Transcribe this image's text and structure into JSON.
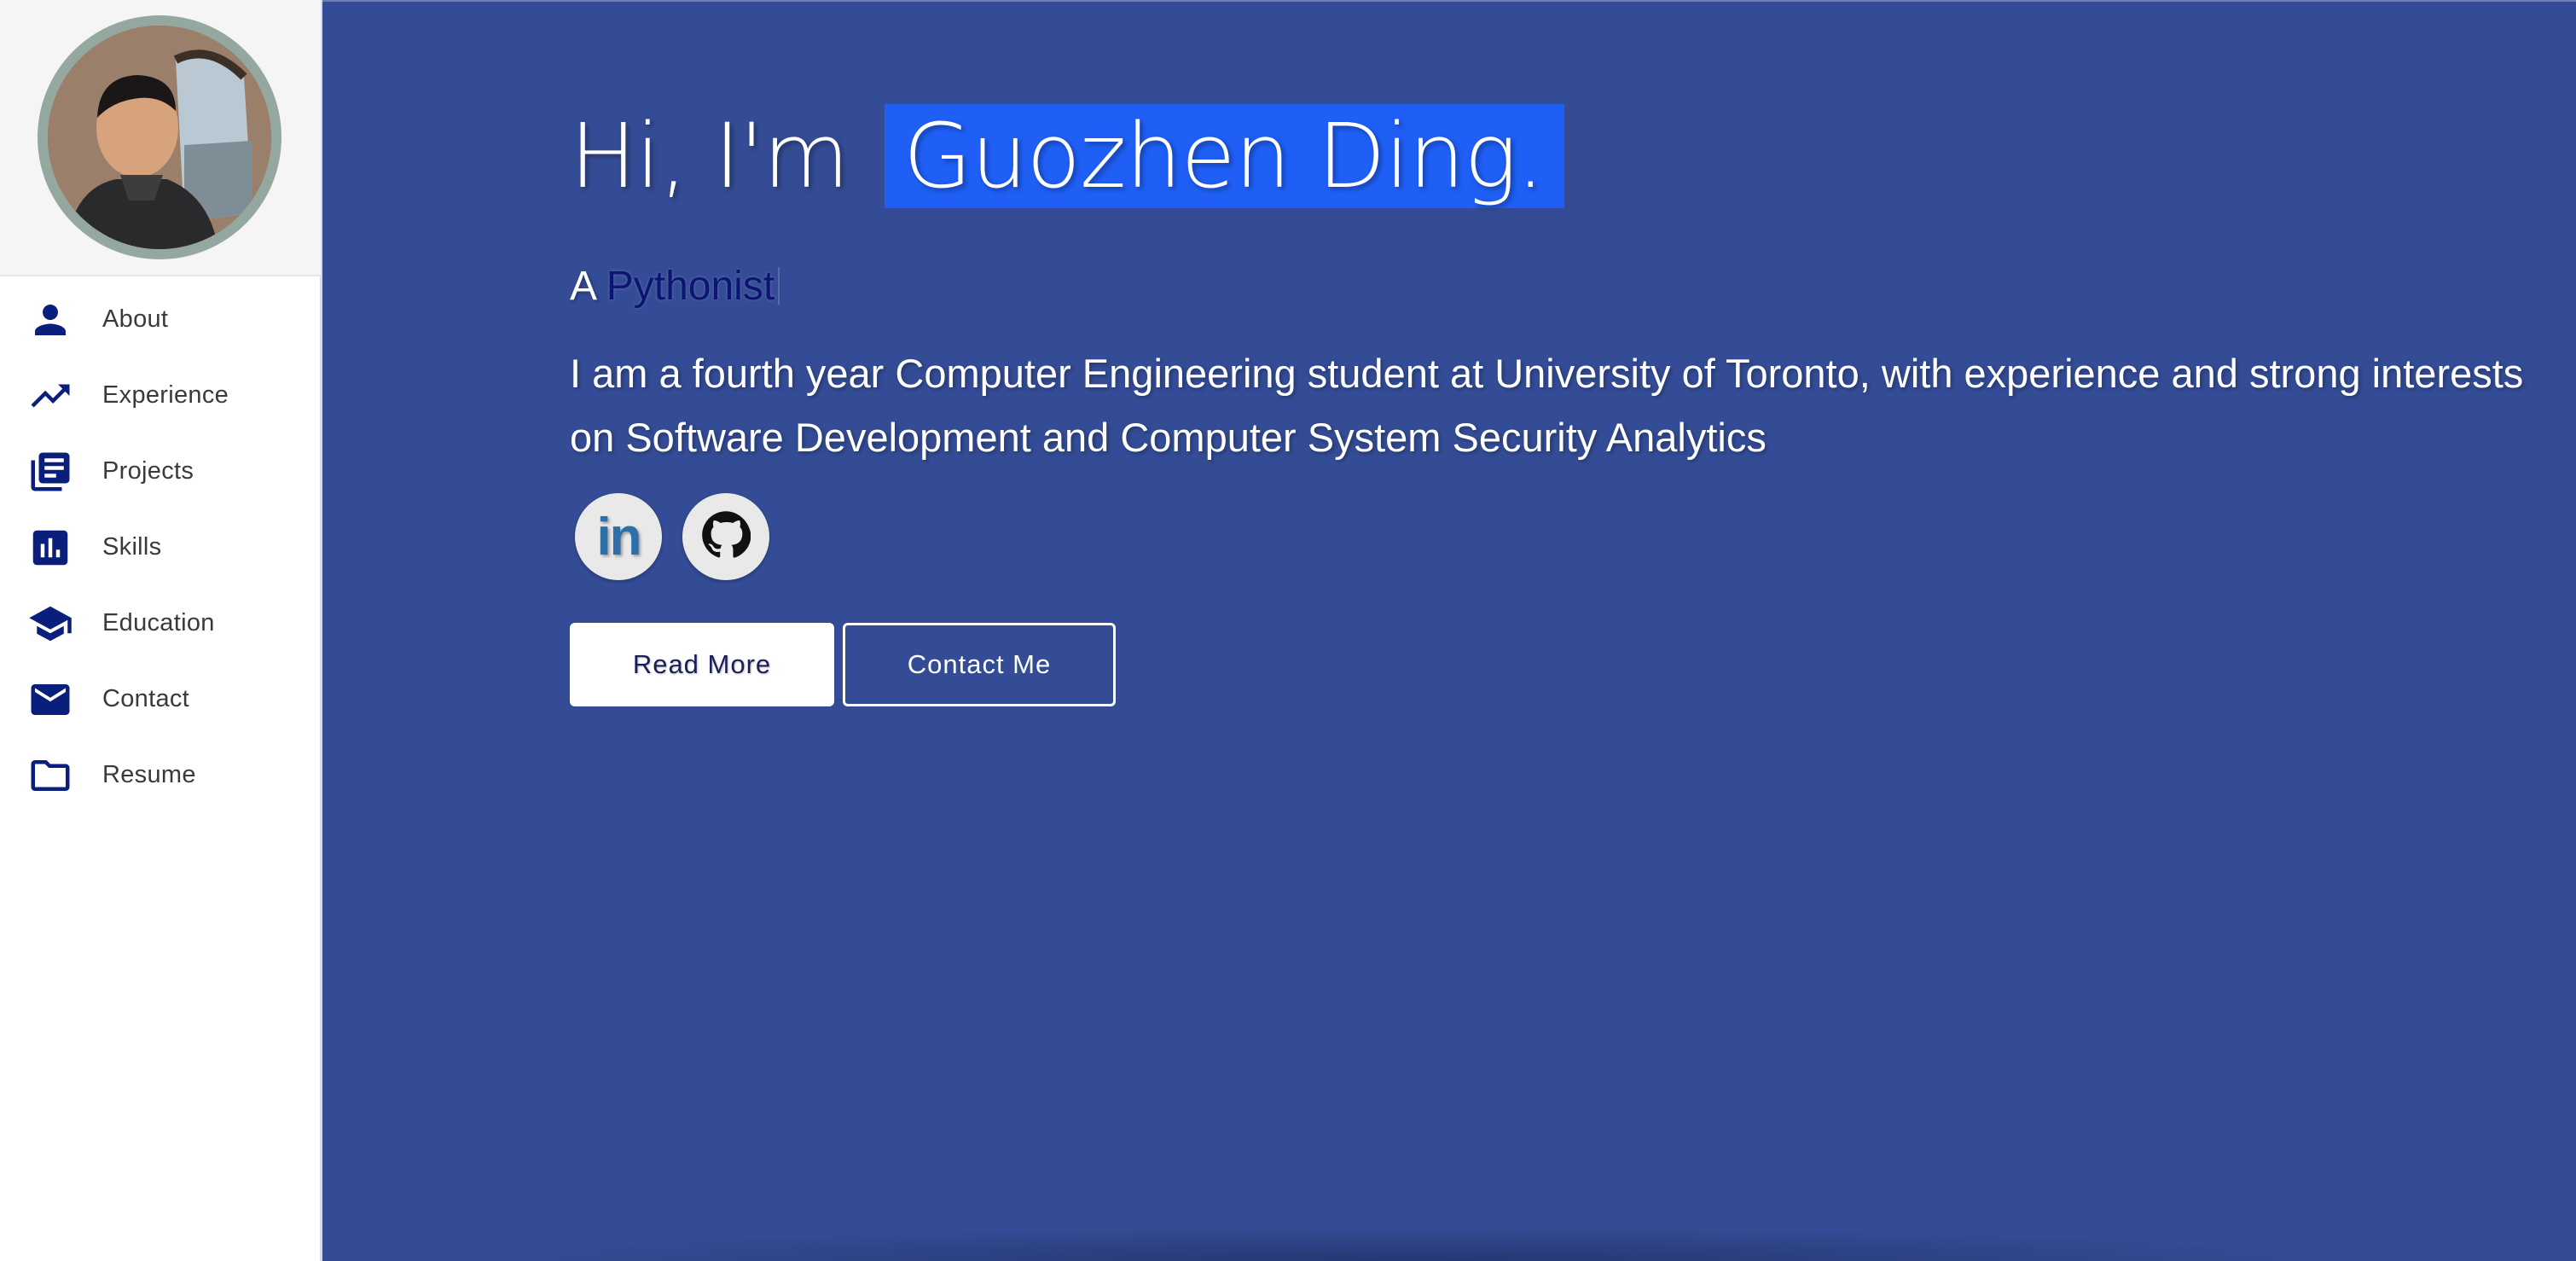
{
  "sidebar": {
    "items": [
      {
        "label": "About",
        "icon": "person-icon"
      },
      {
        "label": "Experience",
        "icon": "trending-up-icon"
      },
      {
        "label": "Projects",
        "icon": "library-books-icon"
      },
      {
        "label": "Skills",
        "icon": "bar-chart-icon"
      },
      {
        "label": "Education",
        "icon": "school-icon"
      },
      {
        "label": "Contact",
        "icon": "mail-icon"
      },
      {
        "label": "Resume",
        "icon": "folder-icon"
      }
    ]
  },
  "hero": {
    "greeting": "Hi, I'm",
    "name": "Guozhen Ding.",
    "subtitle_prefix": "A",
    "role": "Pythonist",
    "bio": "I am a fourth year Computer Engineering student at University of Toronto, with experience and strong interests on Software Development and Computer System Security Analytics"
  },
  "socials": {
    "linkedin_label": "in",
    "linkedin_icon": "linkedin-icon",
    "github_icon": "github-icon"
  },
  "actions": {
    "read_more": "Read More",
    "contact_me": "Contact Me"
  },
  "colors": {
    "main_bg": "#344c95",
    "name_highlight": "#1f5ff6",
    "nav_icon": "#0a1f7c",
    "role_text": "#0d1573"
  }
}
